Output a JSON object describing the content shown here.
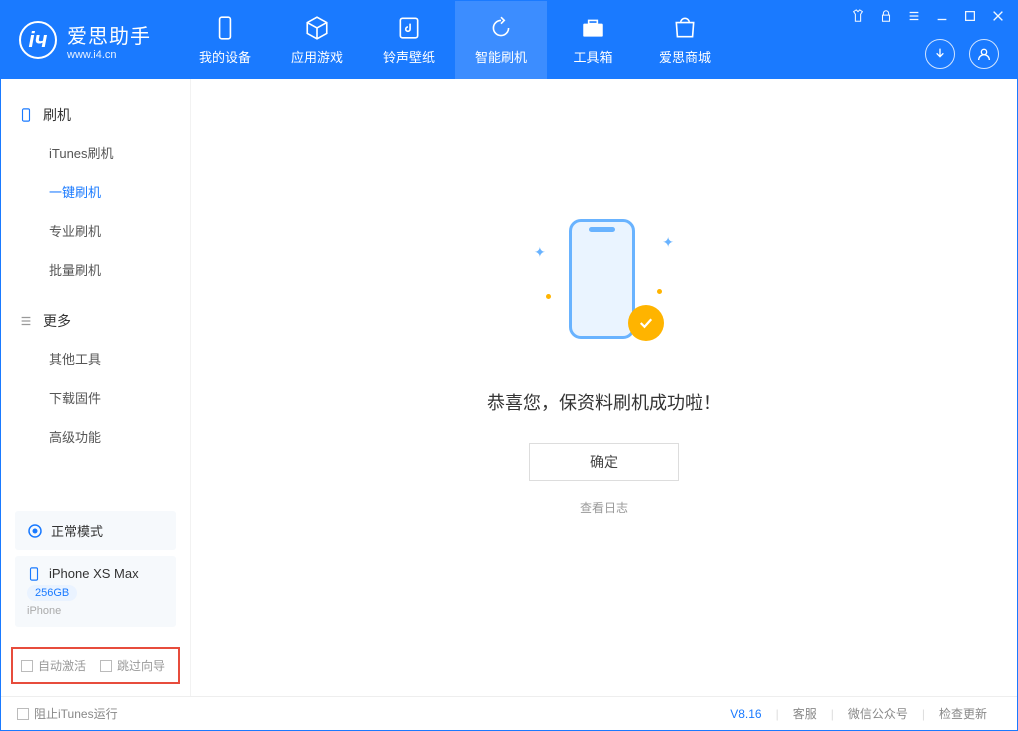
{
  "app": {
    "name": "爱思助手",
    "url": "www.i4.cn"
  },
  "navTabs": [
    {
      "label": "我的设备"
    },
    {
      "label": "应用游戏"
    },
    {
      "label": "铃声壁纸"
    },
    {
      "label": "智能刷机"
    },
    {
      "label": "工具箱"
    },
    {
      "label": "爱思商城"
    }
  ],
  "sidebar": {
    "section1": "刷机",
    "items1": [
      "iTunes刷机",
      "一键刷机",
      "专业刷机",
      "批量刷机"
    ],
    "section2": "更多",
    "items2": [
      "其他工具",
      "下载固件",
      "高级功能"
    ]
  },
  "deviceMode": {
    "label": "正常模式"
  },
  "device": {
    "name": "iPhone XS Max",
    "storage": "256GB",
    "type": "iPhone"
  },
  "options": {
    "autoActivate": "自动激活",
    "skipGuide": "跳过向导"
  },
  "main": {
    "message": "恭喜您，保资料刷机成功啦！",
    "okButton": "确定",
    "logLink": "查看日志"
  },
  "footer": {
    "blockItunes": "阻止iTunes运行",
    "version": "V8.16",
    "links": [
      "客服",
      "微信公众号",
      "检查更新"
    ]
  }
}
